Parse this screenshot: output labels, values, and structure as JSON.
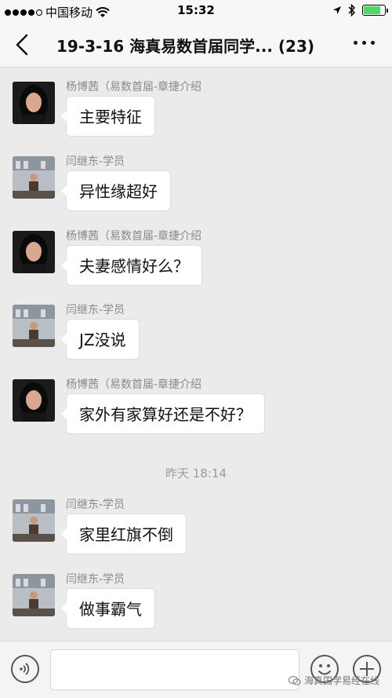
{
  "status_bar": {
    "carrier": "中国移动",
    "time": "15:32"
  },
  "nav": {
    "title": "19-3-16 海真易数首届同学... (23)",
    "back_icon": "chevron-left-icon",
    "more_icon": "more-dots-icon"
  },
  "messages": [
    {
      "sender": "杨博茜（易数首届-章捷介绍",
      "text": "主要特征",
      "avatar": "woman"
    },
    {
      "sender": "闫继东-学员",
      "text": "异性缘超好",
      "avatar": "man"
    },
    {
      "sender": "杨博茜（易数首届-章捷介绍",
      "text": "夫妻感情好么？",
      "avatar": "woman"
    },
    {
      "sender": "闫继东-学员",
      "text": "JZ没说",
      "avatar": "man"
    },
    {
      "sender": "杨博茜（易数首届-章捷介绍",
      "text": "家外有家算好还是不好？",
      "avatar": "woman"
    },
    {
      "sender": "闫继东-学员",
      "text": "家里红旗不倒",
      "avatar": "man"
    },
    {
      "sender": "闫继东-学员",
      "text": "做事霸气",
      "avatar": "man"
    }
  ],
  "timestamp": "昨天 18:14",
  "input_bar": {
    "voice_icon": "voice-icon",
    "emoji_icon": "emoji-icon",
    "plus_icon": "plus-icon",
    "placeholder": ""
  },
  "watermark": "海真国学易经在线",
  "colors": {
    "background": "#ebebeb",
    "bubble": "#ffffff",
    "battery": "#4cd964"
  }
}
